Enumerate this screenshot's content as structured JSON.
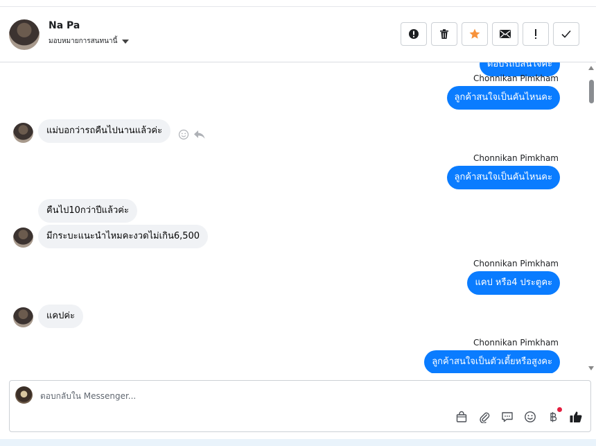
{
  "header": {
    "contact_name": "Na Pa",
    "assign_label": "มอบหมายการสนทนานี้"
  },
  "actions": [
    {
      "name": "spam-button",
      "icon": "alert-circle-icon"
    },
    {
      "name": "delete-button",
      "icon": "trash-icon"
    },
    {
      "name": "star-button",
      "icon": "star-icon"
    },
    {
      "name": "mark-unread-button",
      "icon": "envelope-icon"
    },
    {
      "name": "follow-up-button",
      "icon": "exclamation-icon"
    },
    {
      "name": "mark-done-button",
      "icon": "checkmark-icon"
    }
  ],
  "thread": {
    "sender_name": "Chonnikan Pimkham",
    "partial_top": "ตอบรถบสนใจค่ะ",
    "messages": [
      {
        "dir": "out",
        "text": "ลูกค้าสนใจเป็นคันไหนคะ"
      },
      {
        "dir": "in",
        "text": "แม่บอกว่ารถคืนไปนานแล้วค่ะ"
      },
      {
        "dir": "out",
        "text": "ลูกค้าสนใจเป็นคันไหนคะ"
      },
      {
        "dir": "in",
        "text": "คืนไป10กว่าปีแล้วค่ะ"
      },
      {
        "dir": "in",
        "text": "มีกระบะแนะนำไหมคะงวดไม่เกิน6,500"
      },
      {
        "dir": "out",
        "text": "แคป หรือ4 ประตูคะ"
      },
      {
        "dir": "in",
        "text": "แคปค่ะ"
      },
      {
        "dir": "out",
        "text": "ลูกค้าสนใจเป็นตัวเตี้ยหรือสูงคะ"
      }
    ]
  },
  "composer": {
    "placeholder": "ตอบกลับใน Messenger...",
    "tools": [
      "shopping-bag-icon",
      "paperclip-icon",
      "saved-reply-icon",
      "emoji-icon",
      "baht-payment-icon",
      "thumbs-up-icon"
    ]
  },
  "colors": {
    "outgoing_bubble": "#0a7cff",
    "incoming_bubble": "#f0f2f5",
    "star": "#f7923b",
    "notification_dot": "#e41e3f"
  }
}
